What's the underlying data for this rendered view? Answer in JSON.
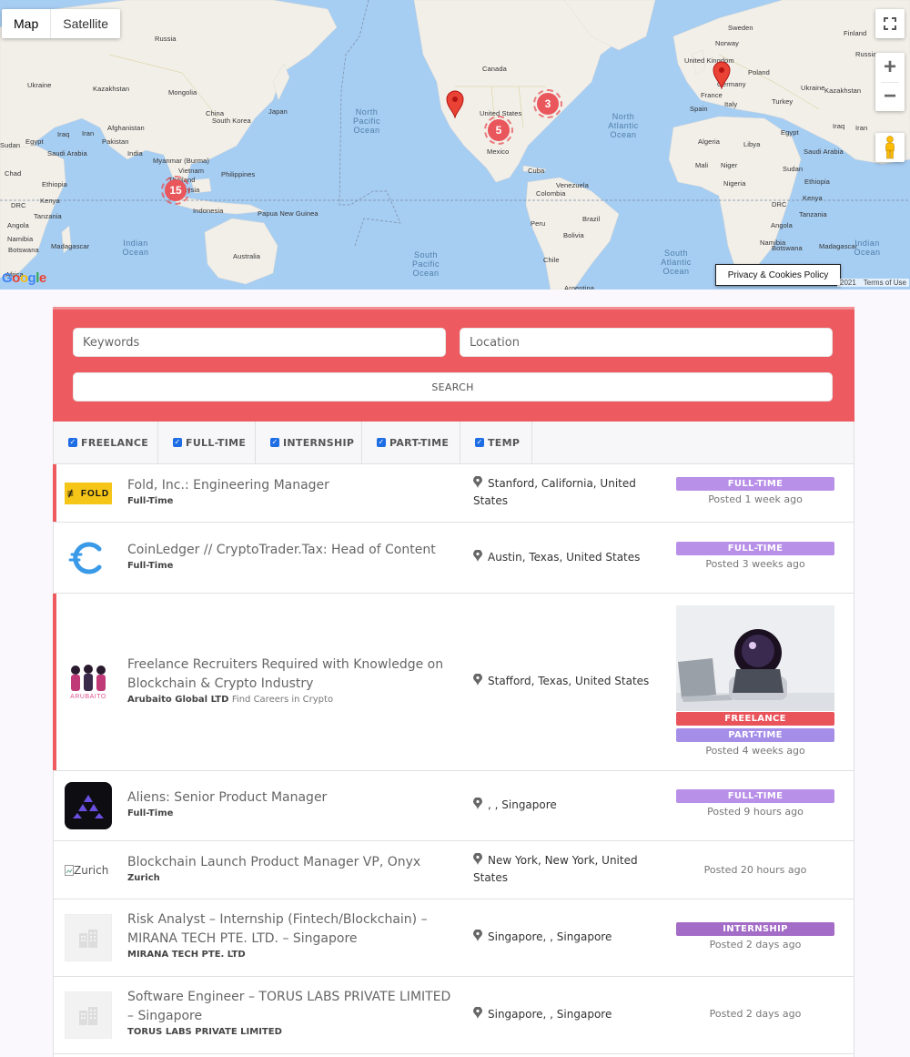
{
  "map": {
    "type_buttons": [
      "Map",
      "Satellite"
    ],
    "privacy_label": "Privacy & Cookies Policy",
    "footer_year": "2021",
    "footer_terms": "Terms of Use",
    "google_logo": "Google",
    "clusters": [
      {
        "name": "cluster-southeast-asia",
        "count": "15"
      },
      {
        "name": "cluster-mexico",
        "count": "5"
      },
      {
        "name": "cluster-east-us",
        "count": "3"
      }
    ],
    "labels": [
      "Finland",
      "Russia",
      "Sweden",
      "Norway",
      "Poland",
      "Ukraine",
      "Kazakhstan",
      "Mongolia",
      "China",
      "Japan",
      "South Korea",
      "Iraq",
      "Iran",
      "Afghanistan",
      "Pakistan",
      "Egypt",
      "Saudi Arabia",
      "India",
      "Myanmar (Burma)",
      "Thailand",
      "Vietnam",
      "Philippines",
      "Malaysia",
      "Indonesia",
      "Papua New Guinea",
      "Australia",
      "Sudan",
      "Chad",
      "Ethiopia",
      "Kenya",
      "DRC",
      "Tanzania",
      "Angola",
      "Namibia",
      "Botswana",
      "Madagascar",
      "Africa",
      "Canada",
      "United States",
      "Mexico",
      "Cuba",
      "Venezuela",
      "Colombia",
      "Peru",
      "Brazil",
      "Bolivia",
      "Chile",
      "Argentina",
      "United Kingdom",
      "Germany",
      "France",
      "Spain",
      "Italy",
      "Turkey",
      "Algeria",
      "Libya",
      "Mali",
      "Niger",
      "Nigeria"
    ],
    "oceans": [
      "North Pacific Ocean",
      "North Atlantic Ocean",
      "Indian Ocean",
      "South Pacific Ocean",
      "South Atlantic Ocean"
    ]
  },
  "search": {
    "keywords_placeholder": "Keywords",
    "location_placeholder": "Location",
    "button_label": "SEARCH"
  },
  "filters": [
    {
      "label": "FREELANCE",
      "checked": true
    },
    {
      "label": "FULL-TIME",
      "checked": true
    },
    {
      "label": "INTERNSHIP",
      "checked": true
    },
    {
      "label": "PART-TIME",
      "checked": true
    },
    {
      "label": "TEMP",
      "checked": true
    }
  ],
  "jobs": [
    {
      "title": "Fold, Inc.: Engineering Manager",
      "company": "Full-Time",
      "tagline": "",
      "location": "Stanford, California, United States",
      "badges": [
        "FULL-TIME"
      ],
      "posted": "Posted 1 week ago",
      "logo_text": "FOLD"
    },
    {
      "title": "CoinLedger // CryptoTrader.Tax: Head of Content",
      "company": "Full-Time",
      "tagline": "",
      "location": "Austin, Texas, United States",
      "badges": [
        "FULL-TIME"
      ],
      "posted": "Posted 3 weeks ago",
      "logo_text": ""
    },
    {
      "title": "Freelance Recruiters Required with Knowledge on Blockchain & Crypto Industry",
      "company": "Arubaito Global LTD",
      "tagline": "Find Careers in Crypto",
      "location": "Stafford, Texas, United States",
      "badges": [
        "FREELANCE",
        "PART-TIME"
      ],
      "posted": "Posted 4 weeks ago",
      "logo_text": "ARUBAITO"
    },
    {
      "title": "Aliens: Senior Product Manager",
      "company": "Full-Time",
      "tagline": "",
      "location": ", , Singapore",
      "badges": [
        "FULL-TIME"
      ],
      "posted": "Posted 9 hours ago",
      "logo_text": ""
    },
    {
      "title": "Blockchain Launch Product Manager VP, Onyx",
      "company": "Zurich",
      "tagline": "",
      "location": "New York, New York, United States",
      "badges": [],
      "posted": "Posted 20 hours ago",
      "logo_text": "Zurich"
    },
    {
      "title": "Risk Analyst – Internship (Fintech/Blockchain) – MIRANA TECH PTE. LTD. – Singapore",
      "company": "MIRANA TECH PTE. LTD",
      "tagline": "",
      "location": "Singapore, , Singapore",
      "badges": [
        "INTERNSHIP"
      ],
      "posted": "Posted 2 days ago",
      "logo_text": ""
    },
    {
      "title": "Software Engineer – TORUS LABS PRIVATE LIMITED – Singapore",
      "company": "TORUS LABS PRIVATE LIMITED",
      "tagline": "",
      "location": "Singapore, , Singapore",
      "badges": [],
      "posted": "Posted 2 days ago",
      "logo_text": ""
    }
  ]
}
